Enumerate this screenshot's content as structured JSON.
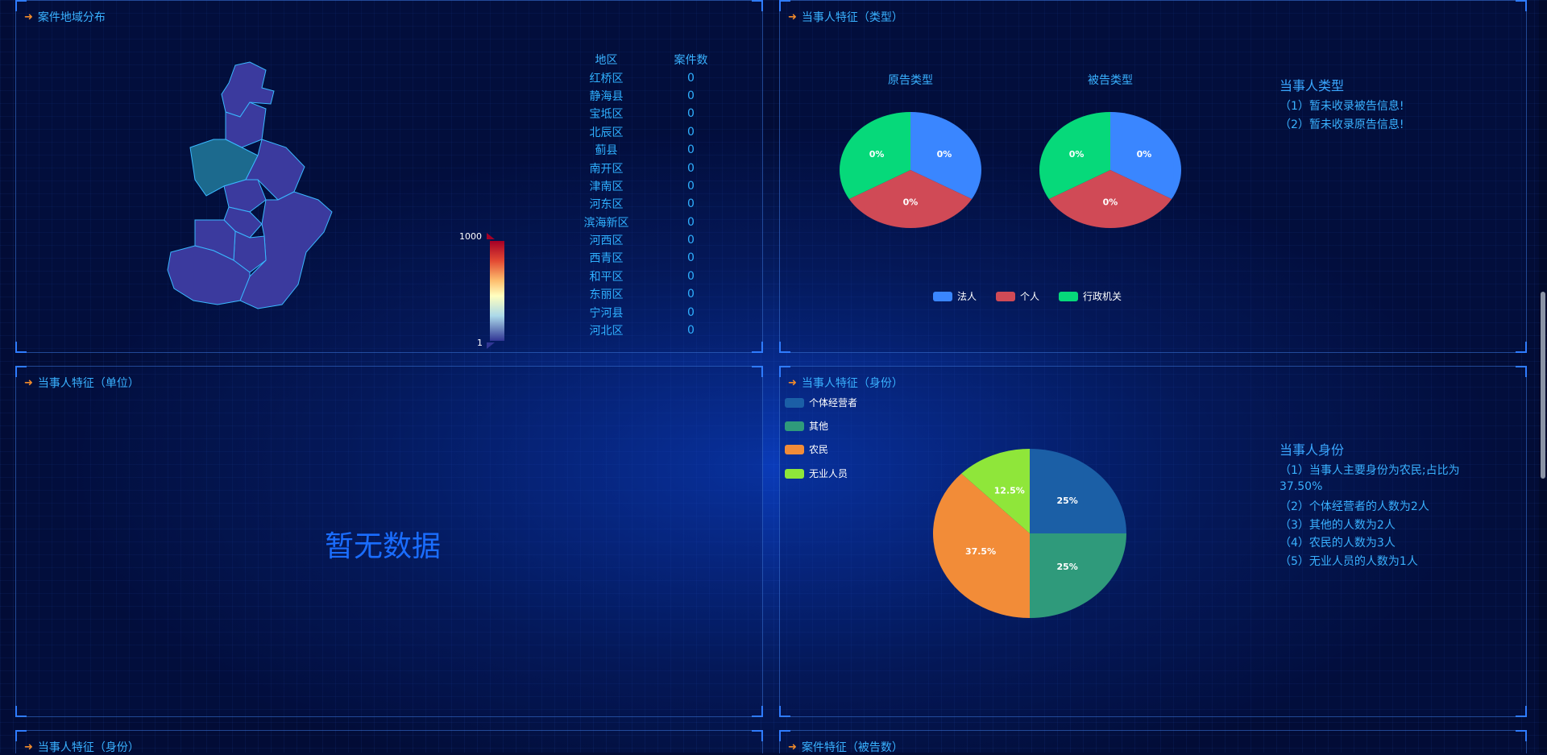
{
  "panels": {
    "region": {
      "title": "案件地域分布",
      "table_headers": [
        "地区",
        "案件数"
      ],
      "rows": [
        [
          "红桥区",
          "0"
        ],
        [
          "静海县",
          "0"
        ],
        [
          "宝坻区",
          "0"
        ],
        [
          "北辰区",
          "0"
        ],
        [
          "蓟县",
          "0"
        ],
        [
          "南开区",
          "0"
        ],
        [
          "津南区",
          "0"
        ],
        [
          "河东区",
          "0"
        ],
        [
          "滨海新区",
          "0"
        ],
        [
          "河西区",
          "0"
        ],
        [
          "西青区",
          "0"
        ],
        [
          "和平区",
          "0"
        ],
        [
          "东丽区",
          "0"
        ],
        [
          "宁河县",
          "0"
        ],
        [
          "河北区",
          "0"
        ]
      ],
      "visual_map": {
        "max": "1000",
        "min": "1"
      }
    },
    "type": {
      "title": "当事人特征（类型）",
      "plaintiff_title": "原告类型",
      "defendant_title": "被告类型",
      "legend": [
        "法人",
        "个人",
        "行政机关"
      ],
      "info_title": "当事人类型",
      "info_lines": [
        "（1）暂未收录被告信息!",
        "（2）暂未收录原告信息!"
      ]
    },
    "unit": {
      "title": "当事人特征（单位）",
      "no_data": "暂无数据"
    },
    "identity": {
      "title": "当事人特征（身份）",
      "legend": [
        "个体经营者",
        "其他",
        "农民",
        "无业人员"
      ],
      "info_title": "当事人身份",
      "info_lines": [
        "（1）当事人主要身份为农民;占比为",
        "37.50%",
        "（2）个体经营者的人数为2人",
        "（3）其他的人数为2人",
        "（4）农民的人数为3人",
        "（5）无业人员的人数为1人"
      ]
    },
    "bottom_left": {
      "title": "当事人特征（身份）"
    },
    "bottom_right": {
      "title": "案件特征（被告数）"
    }
  },
  "chart_data": [
    {
      "type": "pie",
      "title": "原告类型",
      "categories": [
        "法人",
        "个人",
        "行政机关"
      ],
      "values": [
        0,
        0,
        0
      ],
      "labels": [
        "0%",
        "0%",
        "0%"
      ],
      "colors": [
        "#3a86ff",
        "#d04a56",
        "#06d97a"
      ]
    },
    {
      "type": "pie",
      "title": "被告类型",
      "categories": [
        "法人",
        "个人",
        "行政机关"
      ],
      "values": [
        0,
        0,
        0
      ],
      "labels": [
        "0%",
        "0%",
        "0%"
      ],
      "colors": [
        "#3a86ff",
        "#d04a56",
        "#06d97a"
      ]
    },
    {
      "type": "pie",
      "categories": [
        "个体经营者",
        "其他",
        "农民",
        "无业人员"
      ],
      "values": [
        2,
        2,
        3,
        1
      ],
      "labels": [
        "25%",
        "25%",
        "37.5%",
        "12.5%"
      ],
      "colors": [
        "#1b5fa6",
        "#2f9a7b",
        "#f28c38",
        "#8fe63a"
      ]
    }
  ]
}
